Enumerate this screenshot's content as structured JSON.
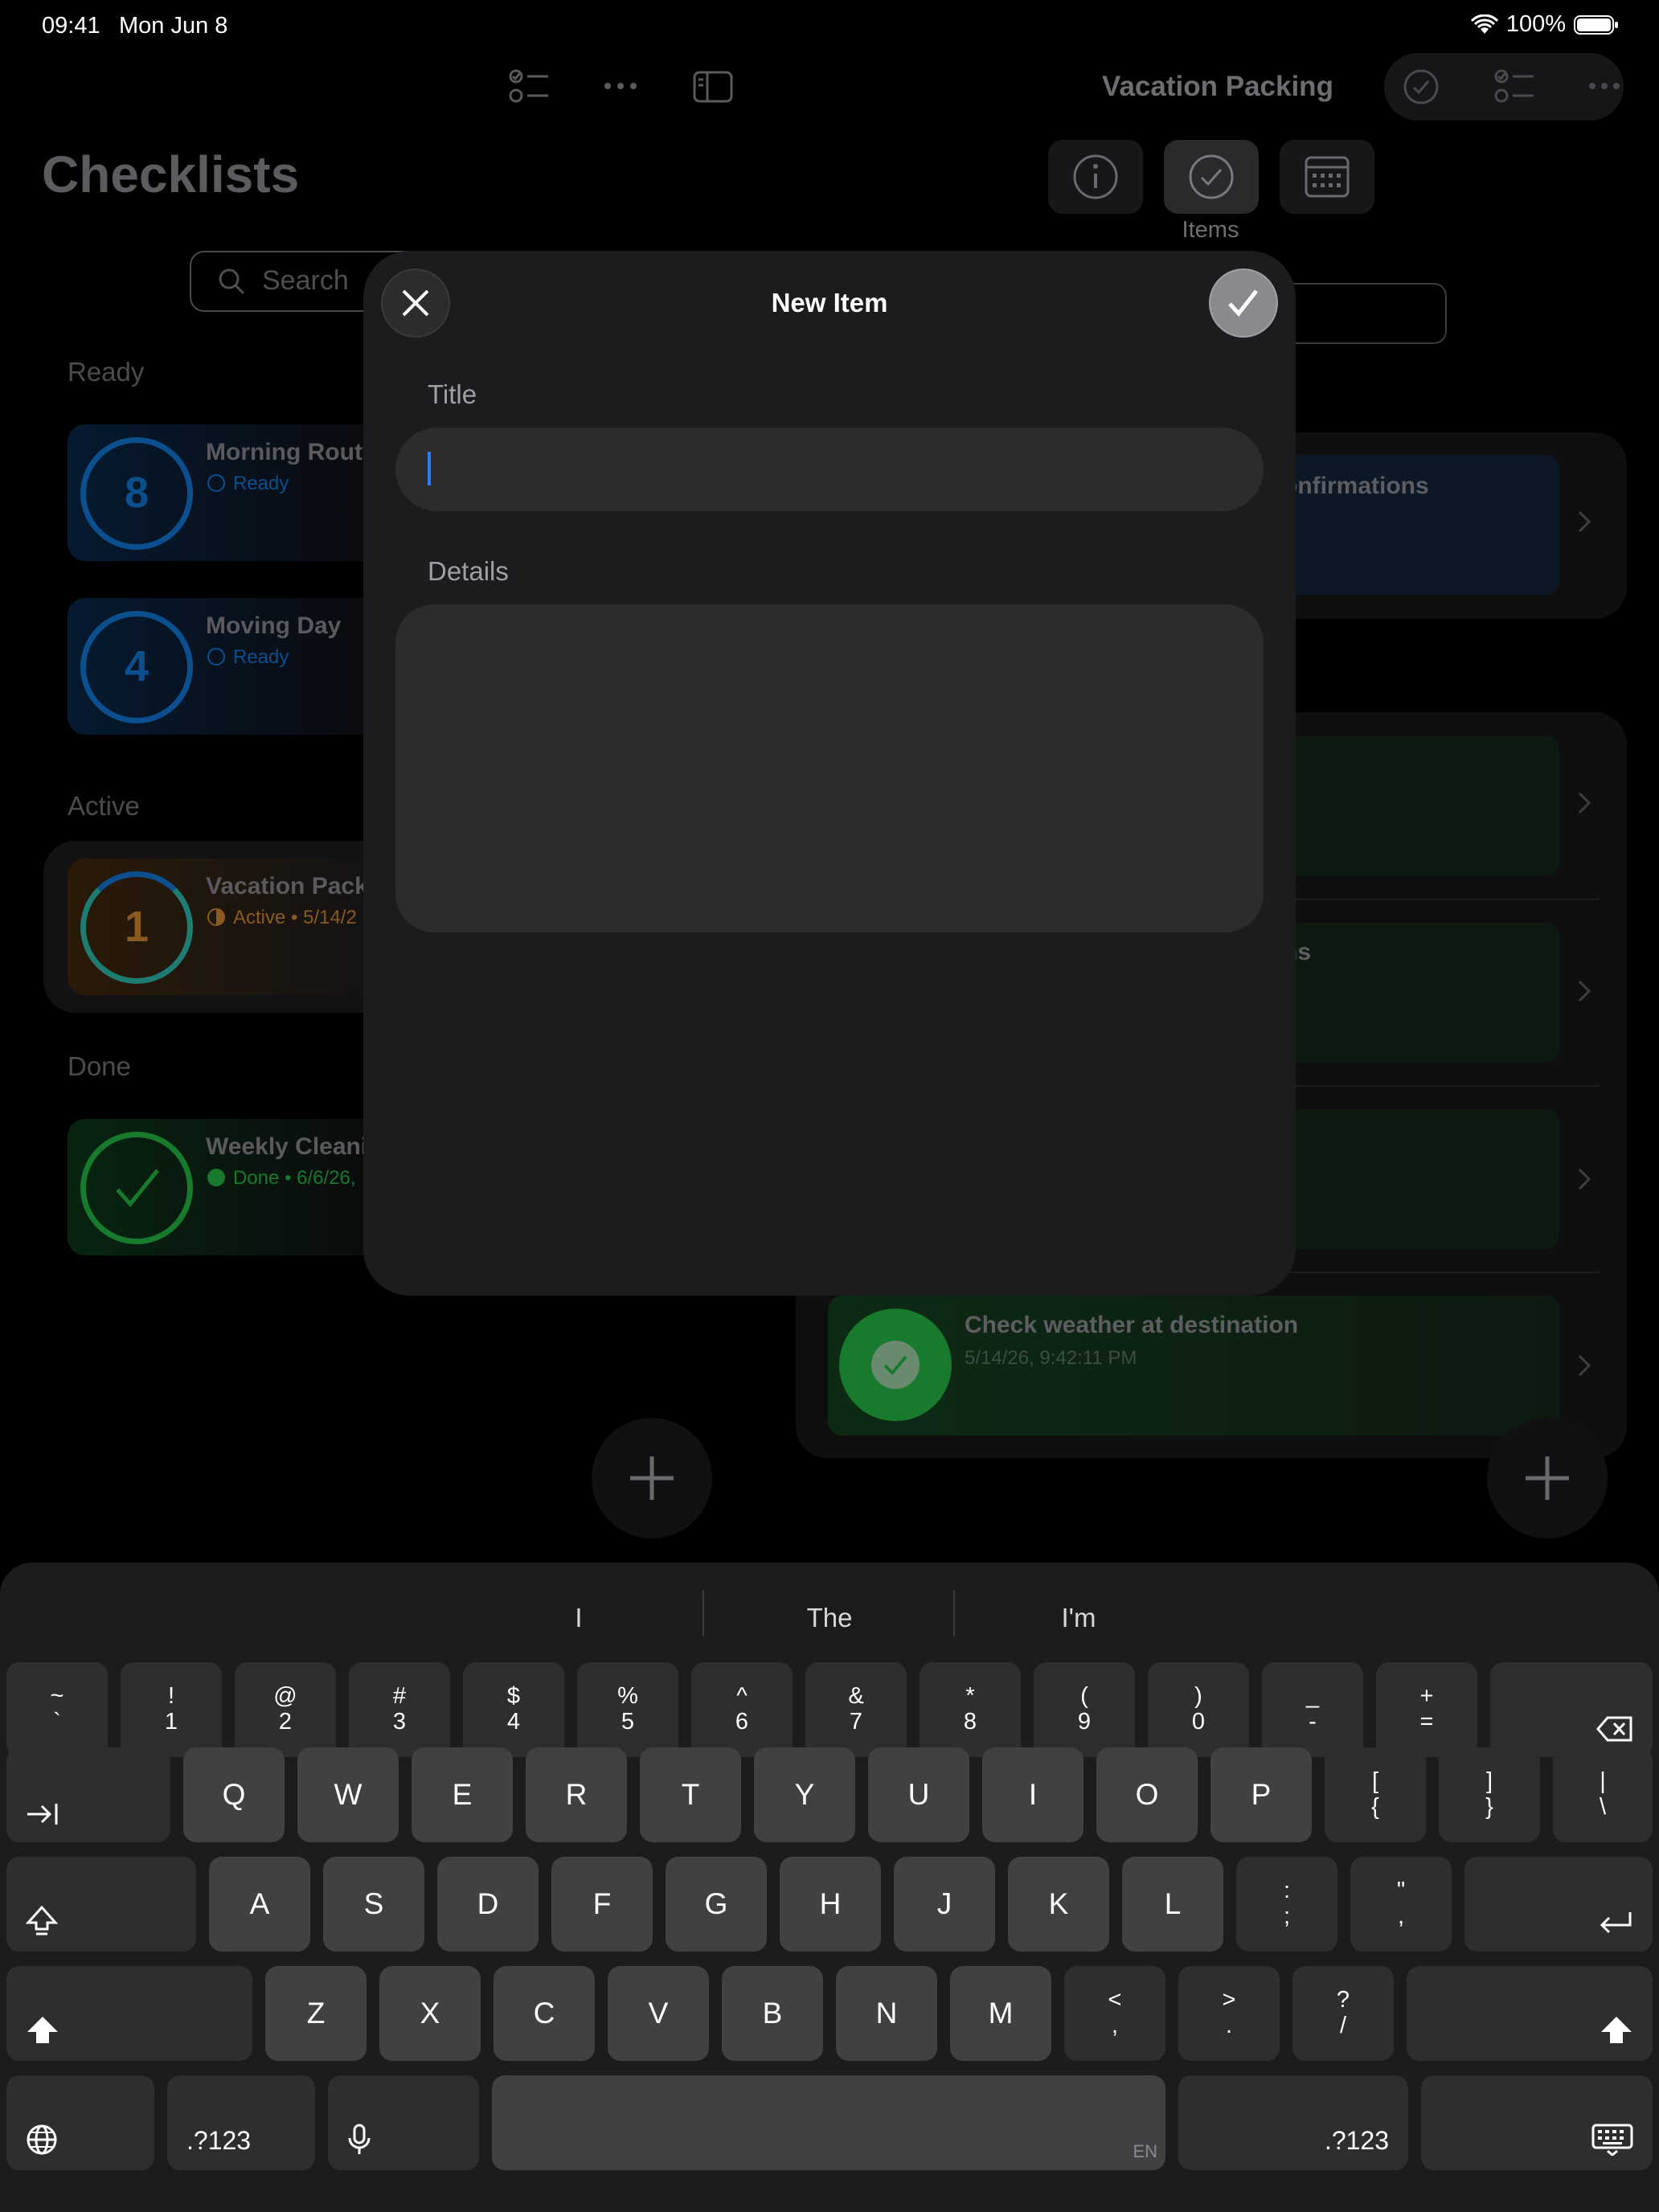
{
  "status_bar": {
    "time": "09:41",
    "date": "Mon Jun 8",
    "battery": "100%"
  },
  "sidebar": {
    "title": "Checklists",
    "search_placeholder": "Search",
    "sections": {
      "ready": "Ready",
      "active": "Active",
      "done": "Done"
    },
    "items": [
      {
        "count": "8",
        "title": "Morning Routi",
        "status": "Ready"
      },
      {
        "count": "4",
        "title": "Moving Day",
        "status": "Ready"
      },
      {
        "count": "1",
        "title": "Vacation Pack",
        "status": "Active • 5/14/2"
      },
      {
        "title": "Weekly Cleani",
        "status": "Done • 6/6/26,"
      }
    ]
  },
  "detail": {
    "title": "Vacation Packing",
    "tab_selected_label": "Items",
    "rows": [
      {
        "title": "onfirmations"
      },
      {
        "title": ""
      },
      {
        "title": "ns"
      },
      {
        "title": ""
      },
      {
        "title": "Check weather at destination",
        "subtitle": "5/14/26, 9:42:11 PM"
      }
    ]
  },
  "modal": {
    "title": "New Item",
    "title_label": "Title",
    "title_value": "",
    "details_label": "Details",
    "details_value": ""
  },
  "keyboard": {
    "suggestions": [
      "I",
      "The",
      "I'm"
    ],
    "number_row": [
      [
        "~",
        "`"
      ],
      [
        "!",
        "1"
      ],
      [
        "@",
        "2"
      ],
      [
        "#",
        "3"
      ],
      [
        "$",
        "4"
      ],
      [
        "%",
        "5"
      ],
      [
        "^",
        "6"
      ],
      [
        "&",
        "7"
      ],
      [
        "*",
        "8"
      ],
      [
        "(",
        "9"
      ],
      [
        ")",
        "0"
      ],
      [
        "_",
        "-"
      ],
      [
        "+",
        "="
      ]
    ],
    "row_q": [
      "Q",
      "W",
      "E",
      "R",
      "T",
      "Y",
      "U",
      "I",
      "O",
      "P"
    ],
    "row_q_extra": [
      [
        "[",
        "{"
      ],
      [
        "]",
        "}"
      ],
      [
        "|",
        "\\"
      ]
    ],
    "row_a": [
      "A",
      "S",
      "D",
      "F",
      "G",
      "H",
      "J",
      "K",
      "L"
    ],
    "row_a_extra": [
      [
        ":",
        ";"
      ],
      [
        "\"",
        ","
      ]
    ],
    "row_z": [
      "Z",
      "X",
      "C",
      "V",
      "B",
      "N",
      "M"
    ],
    "row_z_extra": [
      [
        "<",
        ","
      ],
      [
        ">",
        "."
      ],
      [
        "?",
        "/"
      ]
    ],
    "numbers_key": ".?123",
    "space_lang": "EN"
  }
}
